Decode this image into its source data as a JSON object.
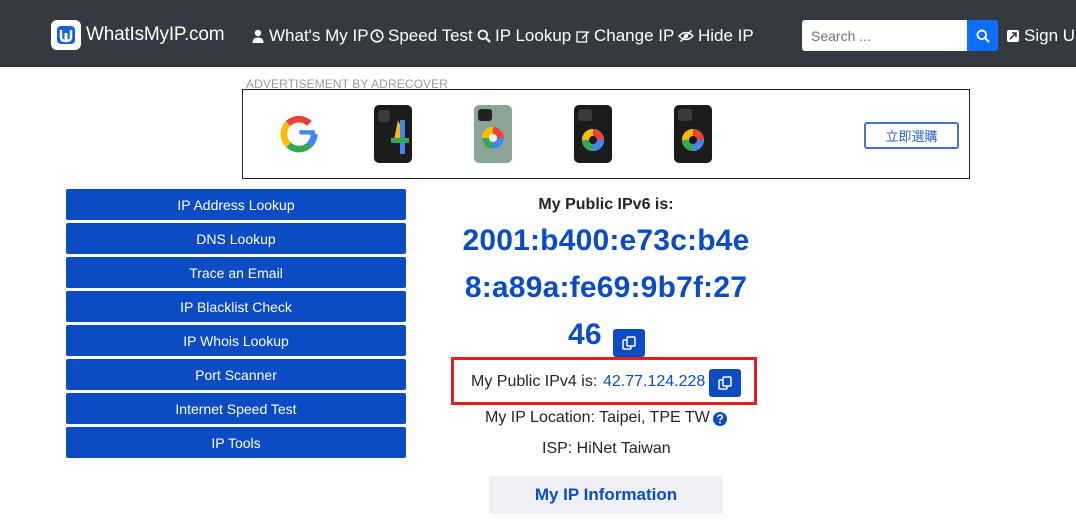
{
  "navbar": {
    "brand": "WhatIsMyIP.com",
    "items": [
      {
        "label": "What's My IP",
        "icon": "user-icon"
      },
      {
        "label": "Speed Test",
        "icon": "clock-icon"
      },
      {
        "label": "IP Lookup",
        "icon": "search-icon"
      },
      {
        "label": "Change IP",
        "icon": "edit-icon"
      },
      {
        "label": "Hide IP",
        "icon": "eye-slash-icon"
      }
    ],
    "search_placeholder": "Search ...",
    "signup": "Sign Up"
  },
  "ad": {
    "label": "ADVERTISEMENT BY ADRECOVER",
    "cta": "立即選購"
  },
  "sidebar": {
    "items": [
      {
        "label": "IP Address Lookup"
      },
      {
        "label": "DNS Lookup"
      },
      {
        "label": "Trace an Email"
      },
      {
        "label": "IP Blacklist Check"
      },
      {
        "label": "IP Whois Lookup"
      },
      {
        "label": "Port Scanner"
      },
      {
        "label": "Internet Speed Test"
      },
      {
        "label": "IP Tools"
      }
    ]
  },
  "main": {
    "ipv6_title": "My Public IPv6 is:",
    "ipv6_lines": [
      "2001:b400:e73c:b4e",
      "8:a89a:fe69:9b7f:27",
      "46"
    ],
    "ipv4_label": "My Public IPv4 is:",
    "ipv4_value": "42.77.124.228",
    "location": "My IP Location: Taipei, TPE TW",
    "isp": "ISP: HiNet Taiwan",
    "info_button": "My IP Information"
  },
  "colors": {
    "navbar_bg": "#343a40",
    "accent": "#0b4cc4",
    "highlight_border": "#e0201a"
  }
}
